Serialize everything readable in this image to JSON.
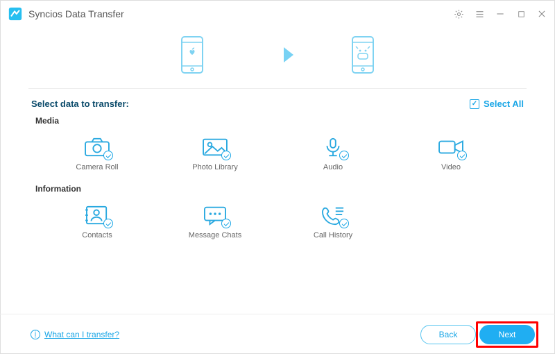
{
  "window": {
    "title": "Syncios Data Transfer"
  },
  "section": {
    "title": "Select data to transfer:",
    "select_all": "Select All"
  },
  "categories": {
    "media": "Media",
    "information": "Information"
  },
  "items": {
    "camera_roll": "Camera Roll",
    "photo_library": "Photo Library",
    "audio": "Audio",
    "video": "Video",
    "contacts": "Contacts",
    "message_chats": "Message Chats",
    "call_history": "Call History"
  },
  "footer": {
    "help_link": "What can I transfer?",
    "back": "Back",
    "next": "Next"
  },
  "colors": {
    "accent": "#1aa6e6",
    "highlight": "#ff0000"
  }
}
